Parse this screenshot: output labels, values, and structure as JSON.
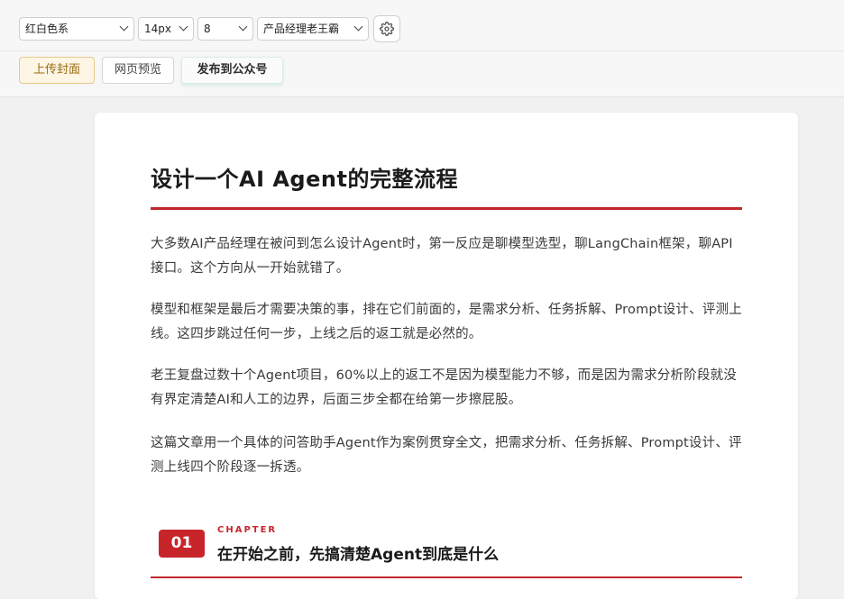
{
  "toolbar": {
    "theme_select": "红白色系",
    "font_size_select": "14px",
    "spacing_select": "8",
    "author_select": "产品经理老王霸",
    "settings_icon": "gear-icon"
  },
  "actions": {
    "upload_cover": "上传封面",
    "web_preview": "网页预览",
    "publish": "发布到公众号"
  },
  "article": {
    "title": "设计一个AI Agent的完整流程",
    "paragraphs": [
      "大多数AI产品经理在被问到怎么设计Agent时，第一反应是聊模型选型，聊LangChain框架，聊API接口。这个方向从一开始就错了。",
      "模型和框架是最后才需要决策的事，排在它们前面的，是需求分析、任务拆解、Prompt设计、评测上线。这四步跳过任何一步，上线之后的返工就是必然的。",
      "老王复盘过数十个Agent项目，60%以上的返工不是因为模型能力不够，而是因为需求分析阶段就没有界定清楚AI和人工的边界，后面三步全都在给第一步擦屁股。",
      "这篇文章用一个具体的问答助手Agent作为案例贯穿全文，把需求分析、任务拆解、Prompt设计、评测上线四个阶段逐一拆透。"
    ],
    "chapter": {
      "number": "01",
      "label": "CHAPTER",
      "title": "在开始之前，先搞清楚Agent到底是什么"
    }
  },
  "colors": {
    "accent": "#c8252b",
    "upload_bg": "#fdf6e4"
  }
}
